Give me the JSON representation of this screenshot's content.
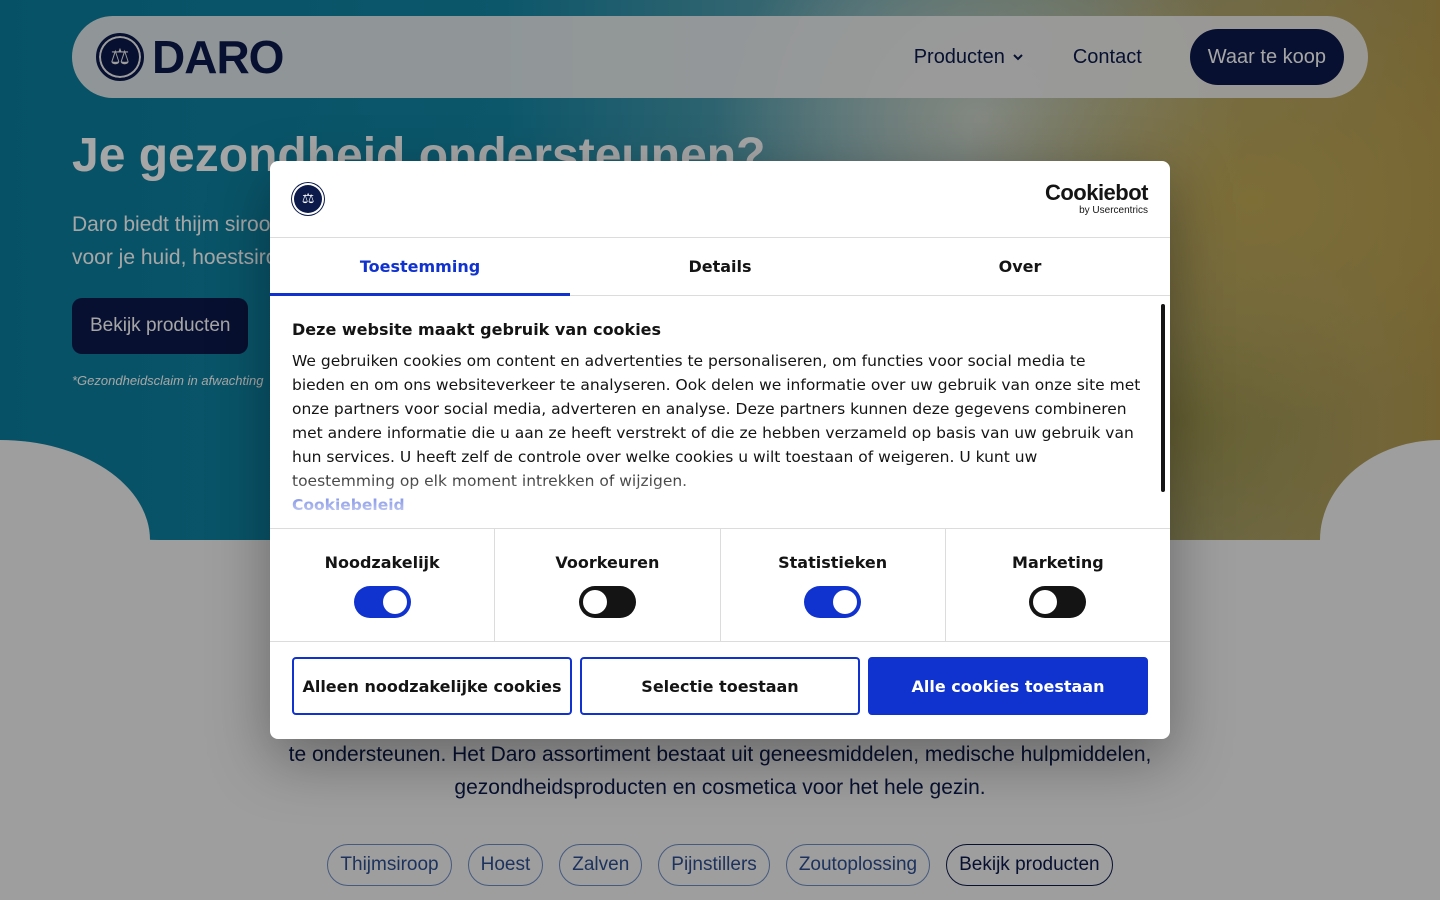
{
  "site": {
    "brand": "DARO",
    "nav": {
      "products": "Producten",
      "contact": "Contact",
      "cta": "Waar te koop"
    },
    "hero": {
      "title": "Je gezondheid ondersteunen?",
      "subtitle_line1": "Daro biedt thijm siroop",
      "subtitle_line2": "voor je huid, hoestsiroo",
      "button": "Bekijk producten",
      "note": "*Gezondheidsclaim in afwachting"
    },
    "intro": {
      "line1": "te ondersteunen. Het Daro assortiment bestaat uit geneesmiddelen, medische hulpmiddelen,",
      "line2": "gezondheidsproducten en cosmetica voor het hele gezin."
    },
    "chips": [
      "Thijmsiroop",
      "Hoest",
      "Zalven",
      "Pijnstillers",
      "Zoutoplossing",
      "Bekijk producten"
    ]
  },
  "cookie": {
    "brand_name": "Cookiebot",
    "brand_by": "by Usercentrics",
    "tabs": [
      "Toestemming",
      "Details",
      "Over"
    ],
    "active_tab": "Toestemming",
    "title": "Deze website maakt gebruik van cookies",
    "text": "We gebruiken cookies om content en advertenties te personaliseren, om functies voor social media te bieden en om ons websiteverkeer te analyseren. Ook delen we informatie over uw gebruik van onze site met onze partners voor social media, adverteren en analyse. Deze partners kunnen deze gegevens combineren met andere informatie die u aan ze heeft verstrekt of die ze hebben verzameld op basis van uw gebruik van hun services. U heeft zelf de controle over welke cookies u wilt toestaan of weigeren. U kunt uw toestemming op elk moment intrekken of wijzigen.",
    "policy_link": "Cookiebeleid",
    "toggles": [
      {
        "label": "Noodzakelijk",
        "on": true
      },
      {
        "label": "Voorkeuren",
        "on": false
      },
      {
        "label": "Statistieken",
        "on": true
      },
      {
        "label": "Marketing",
        "on": false
      }
    ],
    "buttons": {
      "necessary": "Alleen noodzakelijke cookies",
      "selection": "Selectie toestaan",
      "all": "Alle cookies toestaan"
    },
    "colors": {
      "accent": "#1032cf",
      "navy": "#0b1a4a"
    }
  }
}
